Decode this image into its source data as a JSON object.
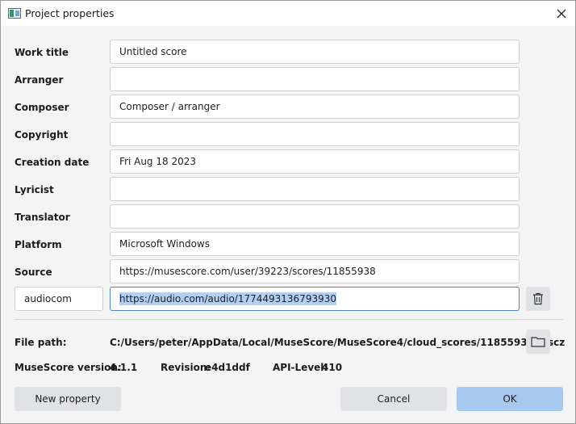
{
  "window": {
    "title": "Project properties"
  },
  "fields": [
    {
      "label": "Work title",
      "value": "Untitled score"
    },
    {
      "label": "Arranger",
      "value": ""
    },
    {
      "label": "Composer",
      "value": "Composer / arranger"
    },
    {
      "label": "Copyright",
      "value": ""
    },
    {
      "label": "Creation date",
      "value": "Fri Aug 18 2023"
    },
    {
      "label": "Lyricist",
      "value": ""
    },
    {
      "label": "Translator",
      "value": ""
    },
    {
      "label": "Platform",
      "value": "Microsoft Windows"
    },
    {
      "label": "Source",
      "value": "https://musescore.com/user/39223/scores/11855938"
    }
  ],
  "custom_property": {
    "key": "audiocom",
    "value": "https://audio.com/audio/1774493136793930"
  },
  "info": {
    "file_path_label": "File path:",
    "file_path": "C:/Users/peter/AppData/Local/MuseScore/MuseScore4/cloud_scores/11855938.mscz",
    "version_label": "MuseScore version:",
    "version": "4.1.1",
    "revision_label": "Revision:",
    "revision": "e4d1ddf",
    "api_label": "API-Level:",
    "api": "410"
  },
  "buttons": {
    "new_property": "New property",
    "cancel": "Cancel",
    "ok": "OK"
  },
  "icons": {
    "app": "musescore-app-icon",
    "close": "close-icon",
    "delete": "trash-icon",
    "browse": "folder-icon"
  },
  "colors": {
    "accent": "#a8c9ef",
    "selection": "#b3cff1",
    "focus_border": "#4f86c6"
  }
}
